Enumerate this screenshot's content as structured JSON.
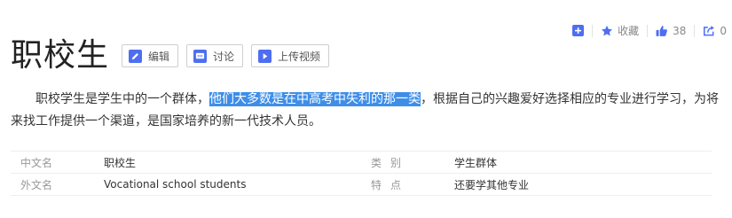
{
  "toolbar": {
    "favorite_label": "收藏",
    "like_count": "38",
    "share_count": "0"
  },
  "title": "职校生",
  "buttons": {
    "edit": "编辑",
    "discuss": "讨论",
    "upload_video": "上传视频"
  },
  "summary": {
    "part1": "职校学生是学生中的一个群体，",
    "highlight": "他们大多数是在中高考中失利的那一类",
    "part2": "，根据自己的兴趣爱好选择相应的专业进行学习，为将来找工作提供一个渠道，是国家培养的新一代技术人员。"
  },
  "info": [
    {
      "label": "中文名",
      "value": "职校生",
      "label2": "类别",
      "value2": "学生群体"
    },
    {
      "label": "外文名",
      "value": "Vocational school students",
      "label2": "特点",
      "value2": "还要学其他专业"
    }
  ],
  "colors": {
    "accent": "#4e6ef2",
    "highlight_bg": "#3e8ee8"
  }
}
